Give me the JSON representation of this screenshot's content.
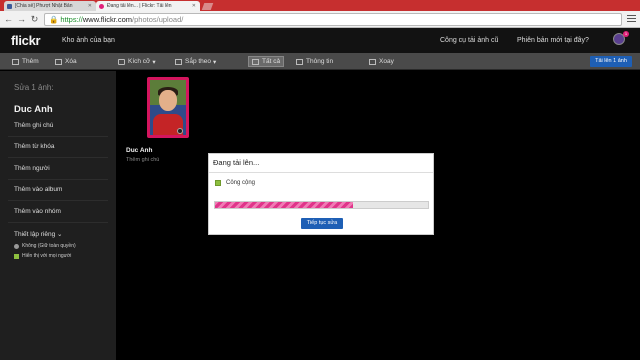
{
  "browser": {
    "tabs": [
      {
        "label": "[Chia sẻ] Phượt Nhật Bản",
        "favicon_color": "#3b5998"
      },
      {
        "label": "Đang tải lên... | Flickr: Tải lên",
        "favicon_color": "#e0207a"
      }
    ],
    "url": {
      "scheme": "https://",
      "host": "www.flickr.com",
      "path": "/photos/upload/"
    }
  },
  "header": {
    "logo": "flickr",
    "left_link": "Kho ảnh của bạn",
    "right_links": [
      "Công cụ tải ảnh cũ",
      "Phiên bản mới tại đây?"
    ],
    "notification_count": "1"
  },
  "toolbar": {
    "buttons": [
      "Thêm",
      "Xóa",
      "Kích cỡ",
      "Sắp theo",
      "Tất cả",
      "Thông tin",
      "Xoay"
    ],
    "publish_label": "Tải lên 1 ảnh"
  },
  "sidebar": {
    "heading": "Sửa 1 ảnh:",
    "name": "Duc Anh",
    "add_desc": "Thêm ghi chú",
    "items": [
      "Thêm từ khóa",
      "Thêm người",
      "Thêm vào album",
      "Thêm vào nhóm"
    ],
    "privacy_title": "Thiết lập riêng",
    "privacy_options": [
      "Không (Giữ toàn quyền)",
      "Hiển thị với mọi người"
    ]
  },
  "photo": {
    "title": "Duc Anh",
    "description": "Thêm ghi chú"
  },
  "dialog": {
    "title": "Đang tải lên...",
    "checkbox_label": "Công cộng",
    "progress_fraction": 0.65,
    "button_label": "Tiếp tục sửa"
  },
  "colors": {
    "accent_blue": "#1e5fb5",
    "progress_pink": "#e0348a",
    "tabbar_red": "#c62f2f"
  }
}
